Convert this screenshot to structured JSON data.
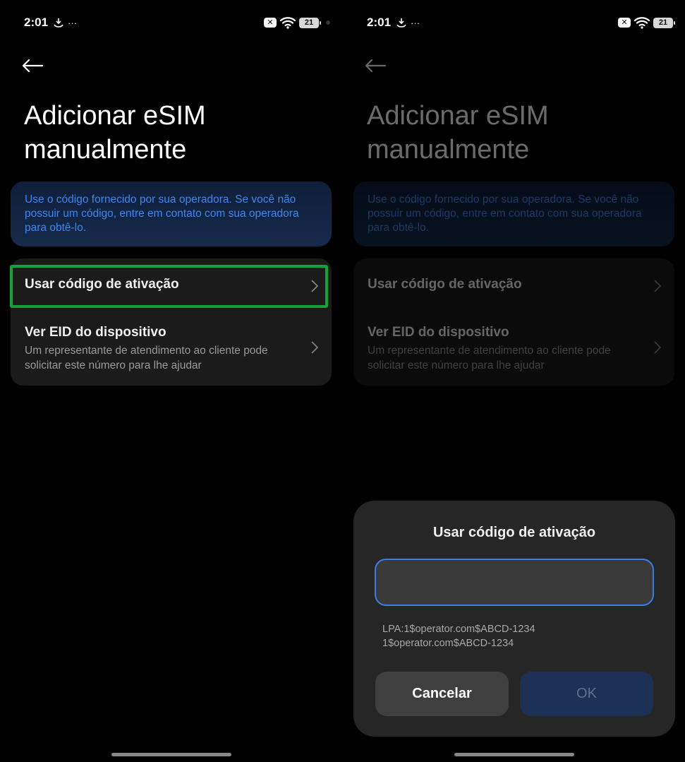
{
  "status": {
    "time": "2:01",
    "extra_dots": "···",
    "battery": "21"
  },
  "page": {
    "title": "Adicionar eSIM manualmente",
    "info": "Use o código fornecido por sua operadora. Se você não possuir um código, entre em contato com sua operadora para obtê-lo."
  },
  "list": {
    "item1_title": "Usar código de ativação",
    "item2_title": "Ver EID do dispositivo",
    "item2_subtitle": "Um representante de atendimento ao cliente pode solicitar este número para lhe ajudar"
  },
  "dialog": {
    "title": "Usar código de ativação",
    "input_value": "",
    "hint_line1": "LPA:1$operator.com$ABCD-1234",
    "hint_line2": "1$operator.com$ABCD-1234",
    "cancel_label": "Cancelar",
    "ok_label": "OK"
  },
  "colors": {
    "highlight": "#14a33a",
    "accent": "#3d86f0",
    "input_border": "#3d7ce6"
  }
}
